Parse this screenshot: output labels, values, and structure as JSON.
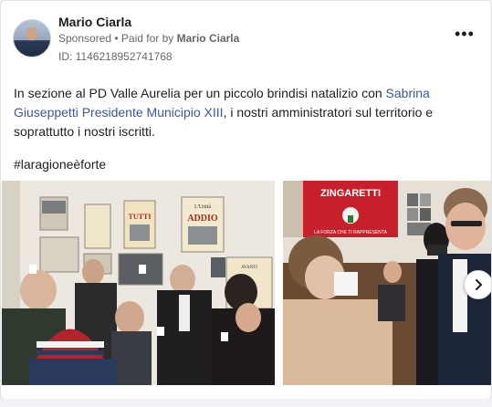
{
  "post": {
    "author": "Mario Ciarla",
    "sponsored": "Sponsored",
    "paid_for_prefix": " • Paid for by ",
    "paid_for_name": "Mario Ciarla",
    "id_label": "ID: 1146218952741768",
    "text_before": "In sezione al PD Valle Aurelia per un piccolo brindisi natalizio con ",
    "text_link": "Sabrina Giuseppetti Presidente Municipio XIII",
    "text_after": ", i nostri amministratori sul territorio e soprattutto i nostri iscritti.",
    "hashtag": "#laragioneèforte",
    "more_icon": "more-horizontal-icon",
    "next_icon": "chevron-right-icon"
  },
  "media": {
    "photo2_banner": "ZINGARETTI",
    "photo2_banner_sub": "LA FORZA CHE TI RAPPRESENTA",
    "photo1_headlines": [
      "AVANTI",
      "TUTTI",
      "L'Unità",
      "ADDIO"
    ]
  },
  "colors": {
    "link": "#385898",
    "text": "#1c1e21",
    "secondary": "#65676b",
    "banner_red": "#c8202a"
  }
}
